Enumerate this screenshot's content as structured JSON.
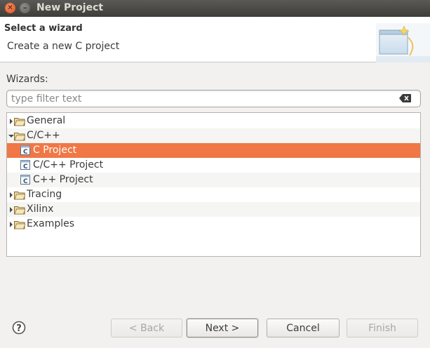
{
  "window": {
    "title": "New Project"
  },
  "banner": {
    "heading": "Select a wizard",
    "description": "Create a new C project"
  },
  "wizards": {
    "label": "Wizards:",
    "filter_placeholder": "type filter text",
    "filter_value": ""
  },
  "tree": {
    "items": [
      {
        "label": "General",
        "kind": "folder",
        "expanded": false,
        "depth": 0
      },
      {
        "label": "C/C++",
        "kind": "folder",
        "expanded": true,
        "depth": 0
      },
      {
        "label": "C Project",
        "kind": "c-project-icon",
        "depth": 1,
        "selected": true
      },
      {
        "label": "C/C++ Project",
        "kind": "c-project-icon",
        "depth": 1
      },
      {
        "label": "C++ Project",
        "kind": "c-project-icon",
        "depth": 1
      },
      {
        "label": "Tracing",
        "kind": "folder",
        "expanded": false,
        "depth": 0
      },
      {
        "label": "Xilinx",
        "kind": "folder",
        "expanded": false,
        "depth": 0
      },
      {
        "label": "Examples",
        "kind": "folder",
        "expanded": false,
        "depth": 0
      }
    ]
  },
  "buttons": {
    "back": "< Back",
    "next": "Next >",
    "cancel": "Cancel",
    "finish": "Finish"
  },
  "colors": {
    "selection": "#f07746",
    "title_bar": "#4a4945",
    "close_button": "#e95f2a"
  }
}
